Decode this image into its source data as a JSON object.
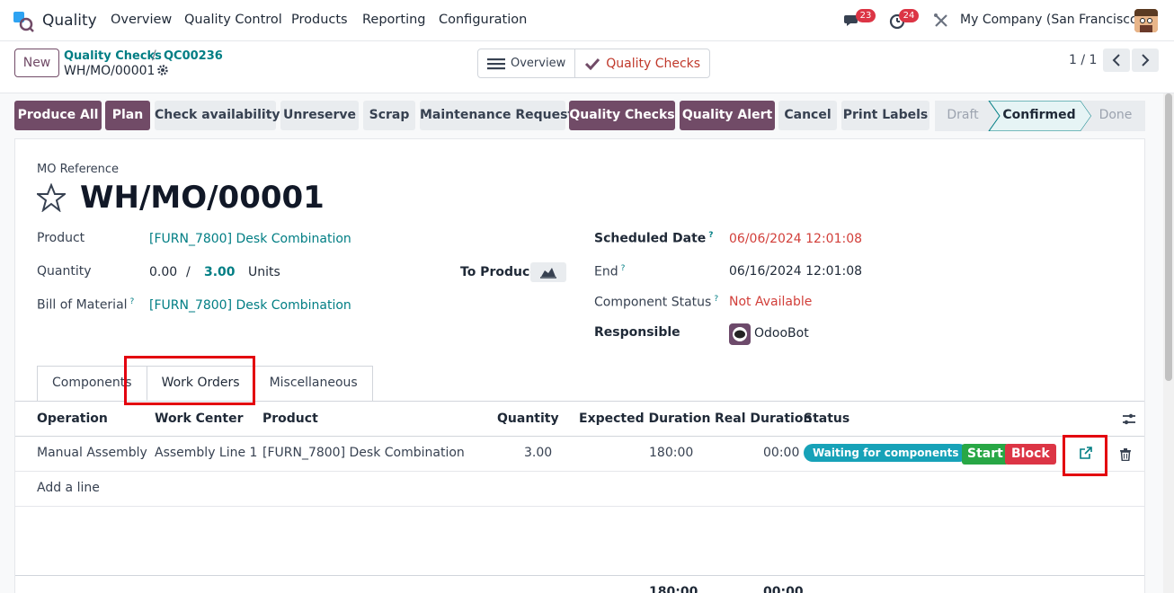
{
  "navbar": {
    "app_name": "Quality",
    "menu": [
      "Overview",
      "Quality Control",
      "Products",
      "Reporting",
      "Configuration"
    ],
    "messages_count": "23",
    "activities_count": "24",
    "company": "My Company (San Francisco)"
  },
  "control_panel": {
    "new_label": "New",
    "breadcrumb": [
      "Quality Checks",
      "QC00236"
    ],
    "breadcrumb_sep": "/",
    "current_record": "WH/MO/00001",
    "view_switch": [
      "Overview",
      "Quality Checks"
    ],
    "pager": "1 / 1"
  },
  "actions": {
    "buttons": [
      "Produce All",
      "Plan",
      "Check availability",
      "Unreserve",
      "Scrap",
      "Maintenance Request",
      "Quality Checks",
      "Quality Alert",
      "Cancel",
      "Print Labels"
    ],
    "statuses": [
      "Draft",
      "Confirmed",
      "Done"
    ]
  },
  "form": {
    "ref_label": "MO Reference",
    "title": "WH/MO/00001",
    "product_label": "Product",
    "product_value": "[FURN_7800] Desk Combination",
    "quantity_label": "Quantity",
    "qty_produced": "0.00",
    "qty_sep": "/",
    "qty_total": "3.00",
    "qty_unit": "Units",
    "to_produce_label": "To Produce",
    "bom_label": "Bill of Material",
    "bom_value": "[FURN_7800] Desk Combination",
    "scheduled_label": "Scheduled Date",
    "scheduled_value": "06/06/2024 12:01:08",
    "end_label": "End",
    "end_value": "06/16/2024 12:01:08",
    "component_status_label": "Component Status",
    "component_status_value": "Not Available",
    "responsible_label": "Responsible",
    "responsible_value": "OdooBot",
    "help_mark": "?"
  },
  "tabs": [
    "Components",
    "Work Orders",
    "Miscellaneous"
  ],
  "table": {
    "headers": [
      "Operation",
      "Work Center",
      "Product",
      "Quantity",
      "Expected Duration",
      "Real Duration",
      "Status"
    ],
    "rows": [
      {
        "operation": "Manual Assembly",
        "work_center": "Assembly Line 1",
        "product": "[FURN_7800] Desk Combination",
        "quantity": "3.00",
        "expected": "180:00",
        "real": "00:00",
        "status": "Waiting for components",
        "start": "Start",
        "block": "Block"
      }
    ],
    "add_line": "Add a line",
    "total_expected": "180:00",
    "total_real": "00:00"
  }
}
